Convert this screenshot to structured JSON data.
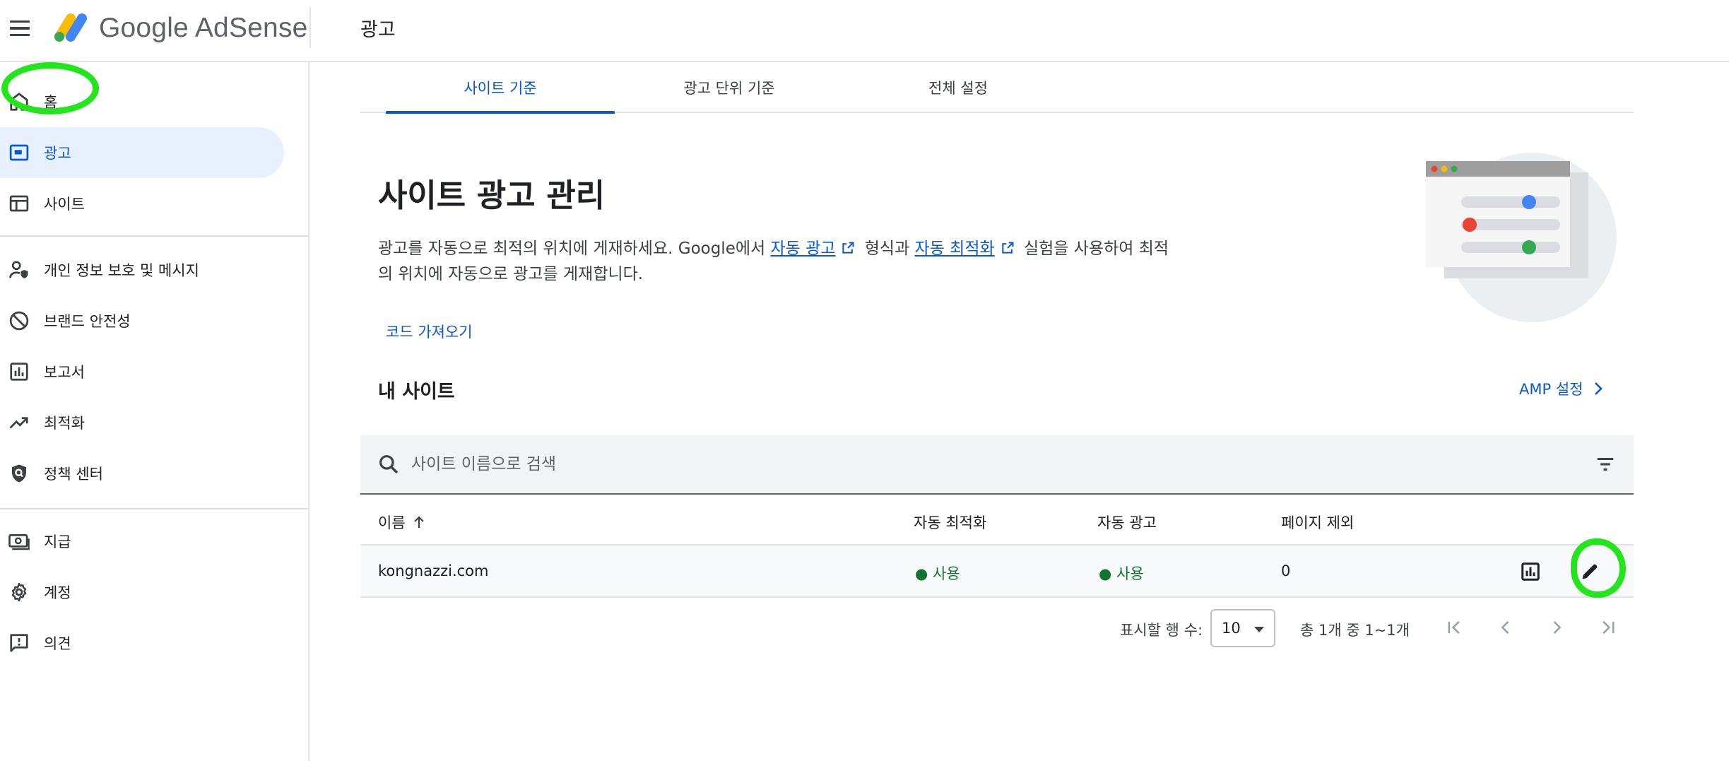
{
  "app": {
    "logo_text": "Google AdSense",
    "page_title": "광고"
  },
  "sidebar": {
    "items": [
      {
        "label": "홈",
        "icon": "home-icon"
      },
      {
        "label": "광고",
        "icon": "ads-icon",
        "active": true
      },
      {
        "label": "사이트",
        "icon": "sites-icon"
      },
      {
        "label": "개인 정보 보호 및 메시지",
        "icon": "privacy-messaging-icon"
      },
      {
        "label": "브랜드 안전성",
        "icon": "block-icon"
      },
      {
        "label": "보고서",
        "icon": "bar-chart-icon"
      },
      {
        "label": "최적화",
        "icon": "trending-up-icon"
      },
      {
        "label": "정책 센터",
        "icon": "policy-shield-icon"
      },
      {
        "label": "지급",
        "icon": "payments-icon"
      },
      {
        "label": "계정",
        "icon": "gear-icon"
      },
      {
        "label": "의견",
        "icon": "feedback-icon"
      }
    ]
  },
  "tabs": [
    {
      "label": "사이트 기준",
      "active": true
    },
    {
      "label": "광고 단위 기준"
    },
    {
      "label": "전체 설정"
    }
  ],
  "main": {
    "headline": "사이트 광고 관리",
    "desc_part1": "광고를 자동으로 최적의 위치에 게재하세요. Google에서 ",
    "desc_link1": "자동 광고",
    "desc_part2": " 형식과 ",
    "desc_link2": "자동 최적화",
    "desc_part3": " 실험을 사용하여 최적의 위치에 자동으로 광고를 게재합니다.",
    "import_code_label": "코드 가져오기",
    "my_sites_title": "내 사이트",
    "amp_settings_label": "AMP 설정"
  },
  "search": {
    "placeholder": "사이트 이름으로 검색",
    "value": ""
  },
  "table": {
    "columns": [
      "이름",
      "자동 최적화",
      "자동 광고",
      "페이지 제외"
    ],
    "rows": [
      {
        "name": "kongnazzi.com",
        "auto_optimize": "사용",
        "auto_ads": "사용",
        "page_exclusions": "0"
      }
    ]
  },
  "pagination": {
    "rows_per_page_label": "표시할 행 수:",
    "rows_per_page_value": "10",
    "range_text": "총 1개 중 1~1개"
  },
  "colors": {
    "accent": "#0b57d0",
    "status_on": "#137333",
    "annotation_marker": "#22e51c"
  }
}
